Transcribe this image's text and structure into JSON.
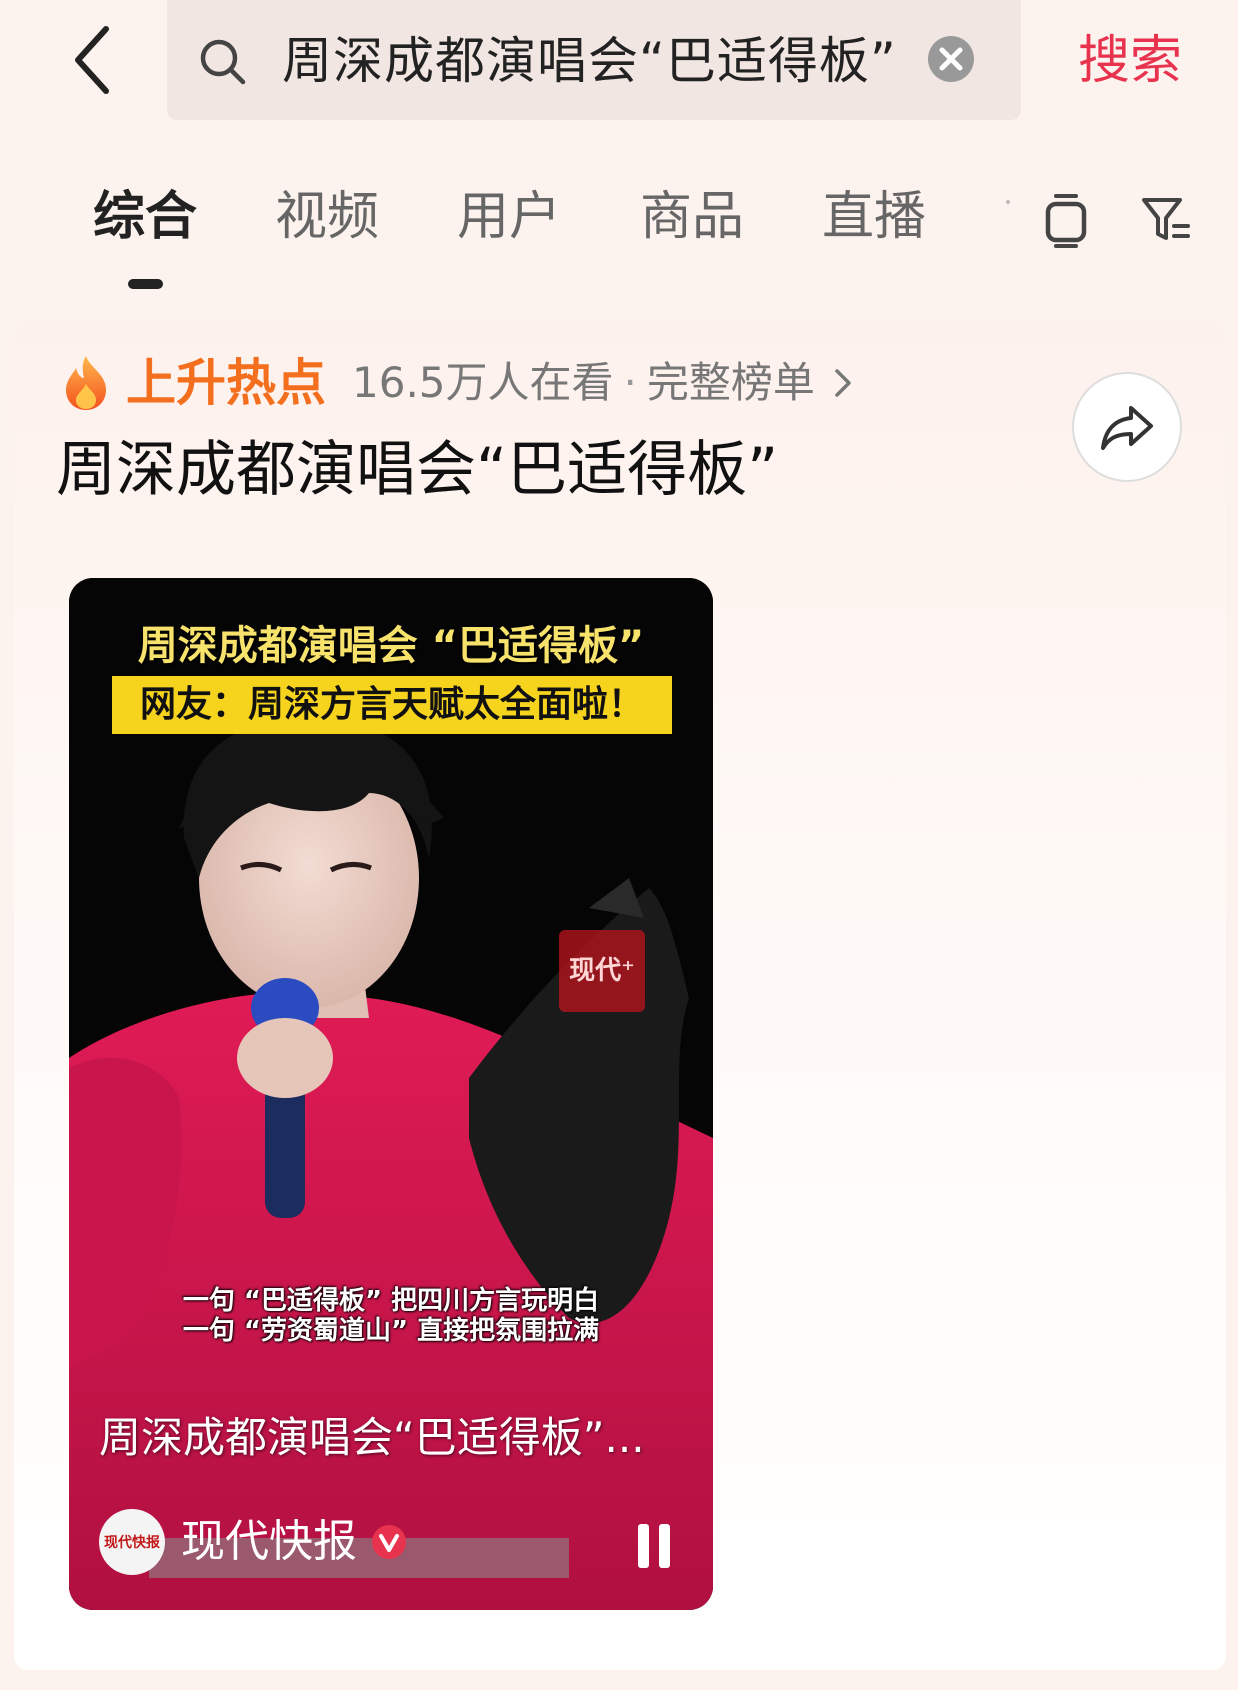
{
  "search": {
    "query": "周深成都演唱会“巴适得板”",
    "submit_label": "搜索"
  },
  "tabs": [
    {
      "label": "综合",
      "active": true
    },
    {
      "label": "视频"
    },
    {
      "label": "用户"
    },
    {
      "label": "商品"
    },
    {
      "label": "直播"
    }
  ],
  "hot": {
    "label": "上升热点",
    "viewers": "16.5万人在看",
    "separator": "·",
    "full_list": "完整榜单"
  },
  "topic": {
    "title": "周深成都演唱会“巴适得板”"
  },
  "video": {
    "caption_title": "周深成都演唱会 “巴适得板”",
    "caption_banner": "网友：周深方言天赋太全面啦！",
    "watermark": "现代⁺",
    "subtitle_line1": "一句 “巴适得板” 把四川方言玩明白",
    "subtitle_line2": "一句 “劳资蜀道山” 直接把氛围拉满",
    "title": "周深成都演唱会“巴适得板”...",
    "author": "现代快报",
    "avatar_text": "现代快报"
  },
  "icons": {
    "back": "back-arrow-icon",
    "search": "search-icon",
    "clear": "clear-icon",
    "tv": "tv-icon",
    "filter": "filter-icon",
    "flame": "flame-icon",
    "share": "share-icon",
    "verified": "verified-icon",
    "pause": "pause-icon"
  },
  "colors": {
    "accent": "#e8334f",
    "hot": "#f36f1e",
    "banner": "#f6d41e",
    "shirt": "#d4164a"
  }
}
